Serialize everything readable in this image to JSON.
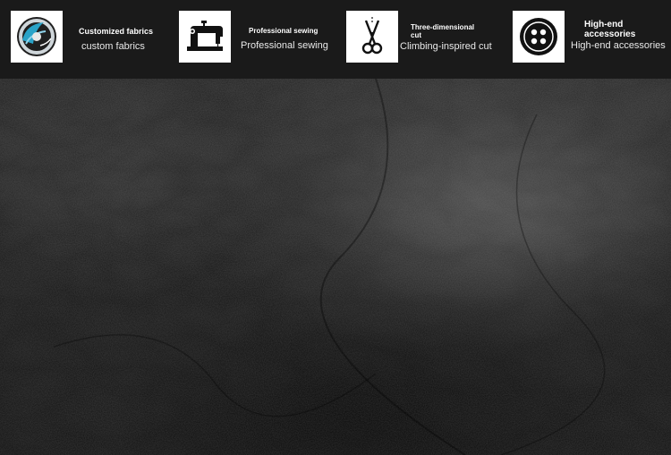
{
  "features": [
    {
      "title": "Customized fabrics",
      "subtitle": "custom fabrics",
      "icon": "fabric-roll-icon"
    },
    {
      "title": "Professional sewing",
      "subtitle": "Professional sewing",
      "icon": "sewing-machine-icon"
    },
    {
      "title": "Three-dimensional cut",
      "subtitle": "Climbing-inspired cut",
      "icon": "scissors-icon"
    },
    {
      "title": "High-end accessories",
      "subtitle": "High-end accessories",
      "icon": "button-icon"
    }
  ],
  "colors": {
    "bar_background": "#1a1a1a",
    "icon_tile": "#ffffff",
    "fabric_accent": "#2aa3c8",
    "leather_base": "#1c1c1c"
  }
}
